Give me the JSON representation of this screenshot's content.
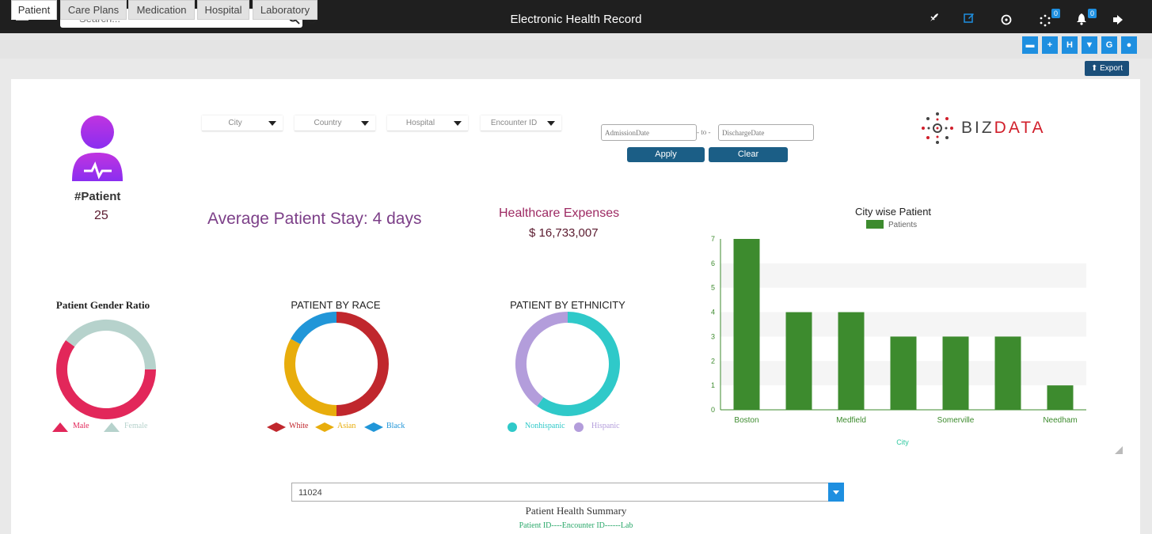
{
  "header": {
    "search_placeholder": "Search...",
    "title": "Electronic Health Record",
    "notif_badge_1": "0",
    "notif_badge_2": "0"
  },
  "tabs": [
    {
      "label": "Patient",
      "active": true
    },
    {
      "label": "Care Plans",
      "active": false
    },
    {
      "label": "Medication",
      "active": false
    },
    {
      "label": "Hospital",
      "active": false
    },
    {
      "label": "Laboratory",
      "active": false
    }
  ],
  "export_label": "Export",
  "filters": {
    "city": "City",
    "country": "Country",
    "hospital": "Hospital",
    "encounter": "Encounter ID",
    "admission_placeholder": "AdmissionDate",
    "to_label": "- to -",
    "discharge_placeholder": "DischargeDate",
    "apply": "Apply",
    "clear": "Clear"
  },
  "logo": {
    "part1": "BIZ",
    "part2": "DATA"
  },
  "kpis": {
    "patient_label": "#Patient",
    "patient_count": "25",
    "avg_stay": "Average Patient Stay: 4 days",
    "expenses_title": "Healthcare Expenses",
    "expenses_value": "$ 16,733,007"
  },
  "colors": {
    "accent_blue": "#1e8fe0",
    "bar_green": "#3d8b2e",
    "male": "#e2275a",
    "female": "#b6d2cc",
    "white_race": "#c0272d",
    "asian": "#e8ad0c",
    "black": "#2196d8",
    "nonhispanic": "#2fc9c9",
    "hispanic": "#b39ddb"
  },
  "gender_chart": {
    "title": "Patient Gender Ratio",
    "legend": [
      "Male",
      "Female"
    ]
  },
  "race_chart": {
    "title": "PATIENT BY RACE",
    "legend": [
      "White",
      "Asian",
      "Black"
    ]
  },
  "ethnicity_chart": {
    "title": "PATIENT BY ETHNICITY",
    "legend": [
      "Nonhispanic",
      "Hispanic"
    ]
  },
  "chart_data": [
    {
      "type": "pie",
      "title": "Patient Gender Ratio",
      "labels": [
        "Male",
        "Female"
      ],
      "values": [
        60,
        40
      ]
    },
    {
      "type": "pie",
      "title": "PATIENT BY RACE",
      "labels": [
        "White",
        "Asian",
        "Black"
      ],
      "values": [
        50,
        33,
        17
      ]
    },
    {
      "type": "pie",
      "title": "PATIENT BY ETHNICITY",
      "labels": [
        "Nonhispanic",
        "Hispanic"
      ],
      "values": [
        60,
        40
      ]
    },
    {
      "type": "bar",
      "title": "City wise Patient",
      "categories": [
        "Boston",
        "",
        "Medfield",
        "",
        "Somerville",
        "",
        "Needham"
      ],
      "series": [
        {
          "name": "Patients",
          "values": [
            7,
            4,
            4,
            3,
            3,
            3,
            1
          ]
        }
      ],
      "xtick_labels": [
        "Boston",
        "Medfield",
        "Somerville",
        "Needham"
      ],
      "xlabel": "City",
      "ylabel": "",
      "ylim": [
        0,
        7
      ],
      "yticks": [
        "0",
        "1",
        "2",
        "3",
        "4",
        "5",
        "6",
        "7"
      ],
      "legend_position": "top"
    }
  ],
  "summary": {
    "select_value": "11024",
    "title": "Patient Health Summary",
    "columns": "Patient ID----Encounter ID------Lab"
  }
}
